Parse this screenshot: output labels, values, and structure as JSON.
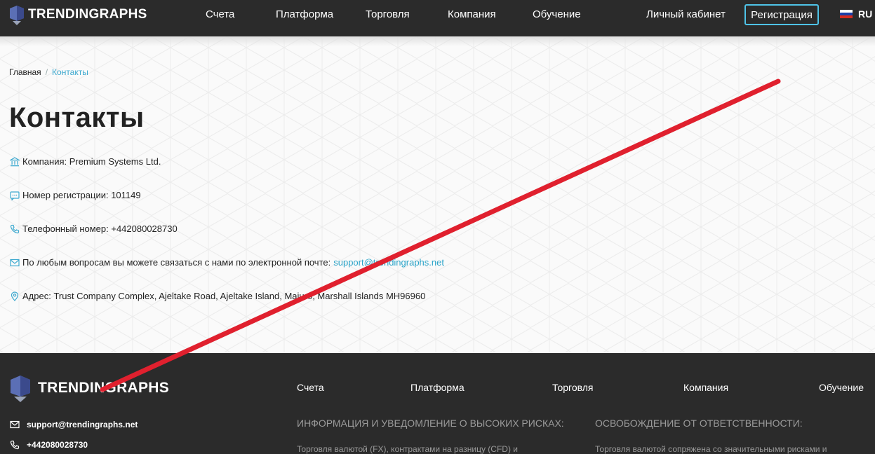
{
  "header": {
    "logo_text": "TRENDINGRAPHS",
    "nav": [
      "Счета",
      "Платформа",
      "Торговля",
      "Компания",
      "Обучение"
    ],
    "cabinet_label": "Личный кабинет",
    "register_label": "Регистрация",
    "lang": "RU"
  },
  "breadcrumb": {
    "home": "Главная",
    "separator": "/",
    "current": "Контакты"
  },
  "page_title": "Контакты",
  "contacts": {
    "company": "Компания: Premium Systems Ltd.",
    "registration": "Номер регистрации: 101149",
    "phone": "Телефонный номер: +442080028730",
    "email_text": "По любым вопросам вы можете связаться с нами по электронной почте:",
    "email_link": "support@trendingraphs.net",
    "address": "Адрес: Trust Company Complex, Ajeltake Road, Ajeltake Island, Majuro, Marshall Islands MH96960"
  },
  "footer": {
    "logo_text": "TRENDINGRAPHS",
    "nav": [
      "Счета",
      "Платформа",
      "Торговля",
      "Компания",
      "Обучение"
    ],
    "email": "support@trendingraphs.net",
    "phone": "+442080028730",
    "risk_heading": "ИНФОРМАЦИЯ И УВЕДОМЛЕНИЕ О ВЫСОКИХ РИСКАХ:",
    "risk_text": "Торговля валютой (FX), контрактами на разницу (CFD) и",
    "disclaimer_heading": "ОСВОБОЖДЕНИЕ ОТ ОТВЕТСТВЕННОСТИ:",
    "disclaimer_text": "Торговля валютой сопряжена со значительными рисками и"
  },
  "colors": {
    "header_bg": "#2b2b2b",
    "accent": "#4fc3e8",
    "link": "#2ba4c8",
    "annotation_arrow": "#e0202e"
  }
}
